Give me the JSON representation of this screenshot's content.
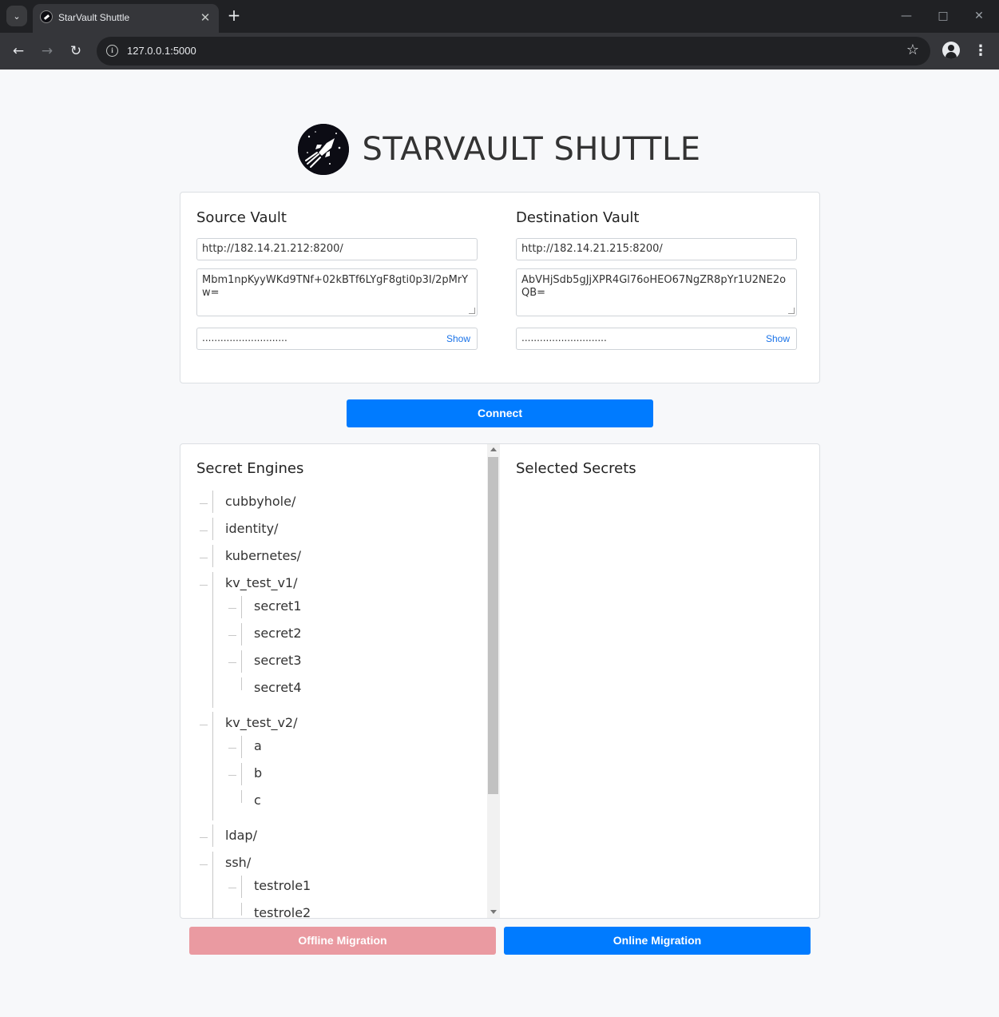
{
  "browser": {
    "tab_title": "StarVault Shuttle",
    "url": "127.0.0.1:5000"
  },
  "app": {
    "title": "STARVAULT SHUTTLE"
  },
  "source": {
    "heading": "Source Vault",
    "url": "http://182.14.21.212:8200/",
    "token": "Mbm1npKyyWKd9TNf+02kBTf6LYgF8gti0p3I/2pMrYw=",
    "password_mask": "............................",
    "show_label": "Show"
  },
  "destination": {
    "heading": "Destination Vault",
    "url": "http://182.14.21.215:8200/",
    "token": "AbVHjSdb5gJjXPR4Gl76oHEO67NgZR8pYr1U2NE2oQB=",
    "password_mask": "............................",
    "show_label": "Show"
  },
  "actions": {
    "connect": "Connect",
    "offline_migration": "Offline Migration",
    "online_migration": "Online Migration"
  },
  "engines": {
    "heading": "Secret Engines",
    "items": [
      {
        "label": "cubbyhole/"
      },
      {
        "label": "identity/"
      },
      {
        "label": "kubernetes/"
      },
      {
        "label": "kv_test_v1/",
        "children": [
          "secret1",
          "secret2",
          "secret3",
          "secret4"
        ]
      },
      {
        "label": "kv_test_v2/",
        "children": [
          "a",
          "b",
          "c"
        ]
      },
      {
        "label": "ldap/"
      },
      {
        "label": "ssh/",
        "children": [
          "testrole1",
          "testrole2"
        ]
      }
    ]
  },
  "selected": {
    "heading": "Selected Secrets"
  }
}
